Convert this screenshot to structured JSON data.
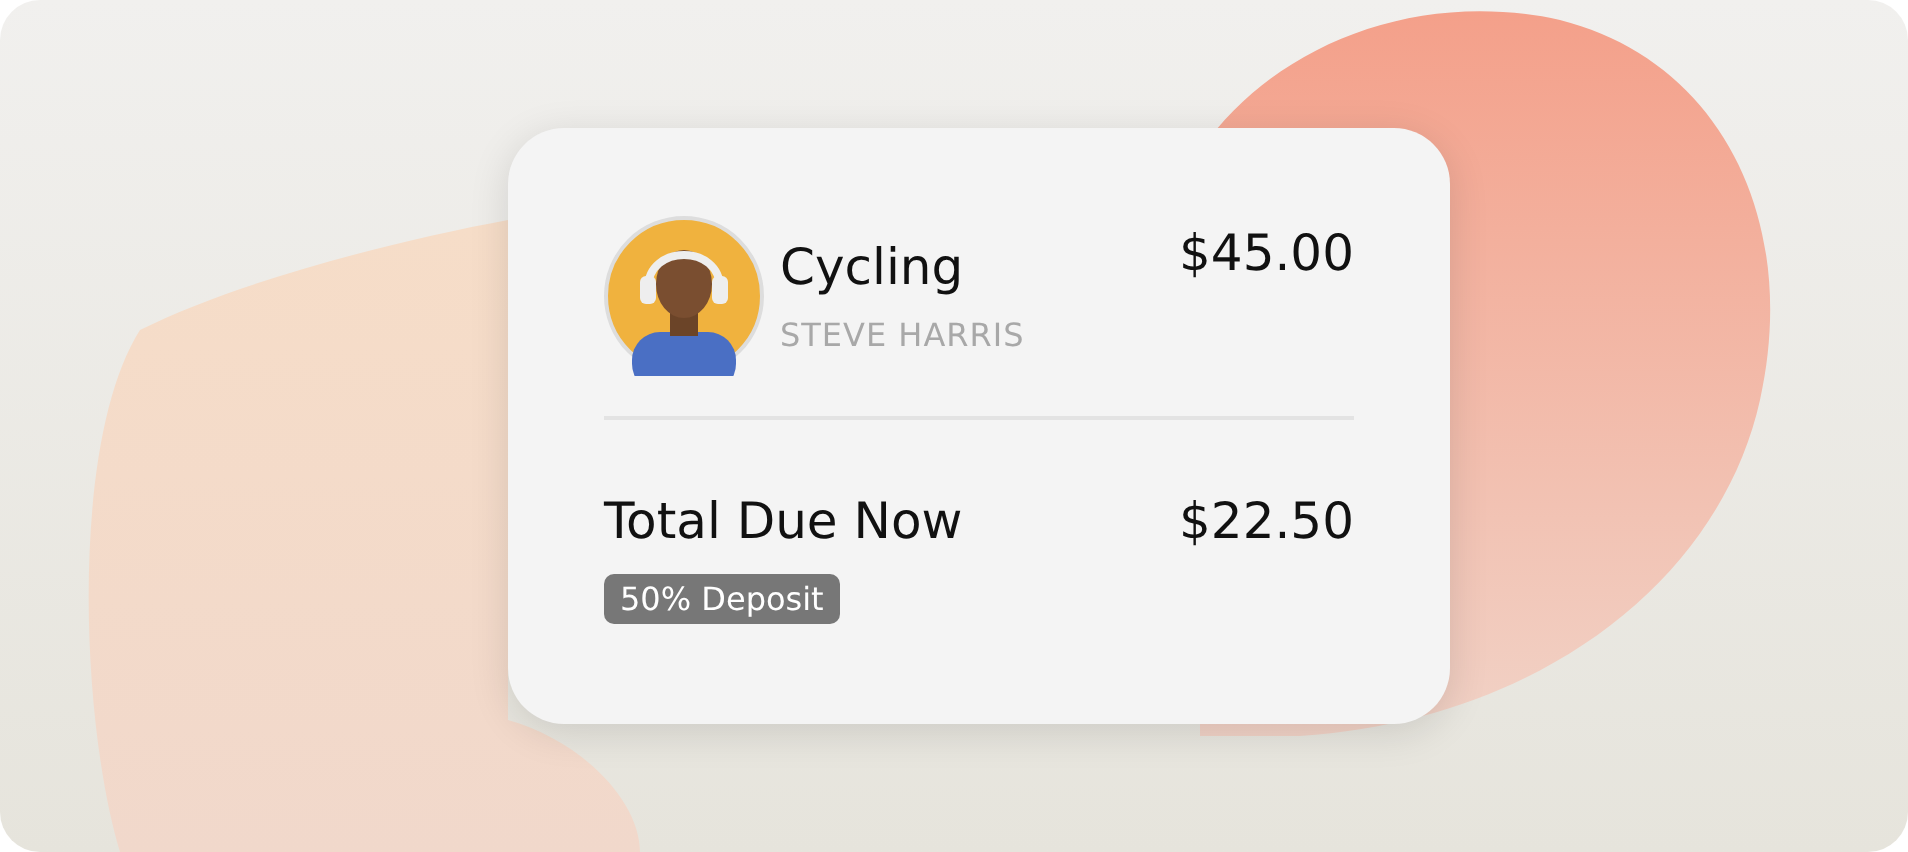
{
  "booking": {
    "class_name": "Cycling",
    "instructor": "STEVE HARRIS",
    "price": "$45.00"
  },
  "total": {
    "label": "Total Due Now",
    "amount": "$22.50",
    "badge": "50% Deposit"
  }
}
